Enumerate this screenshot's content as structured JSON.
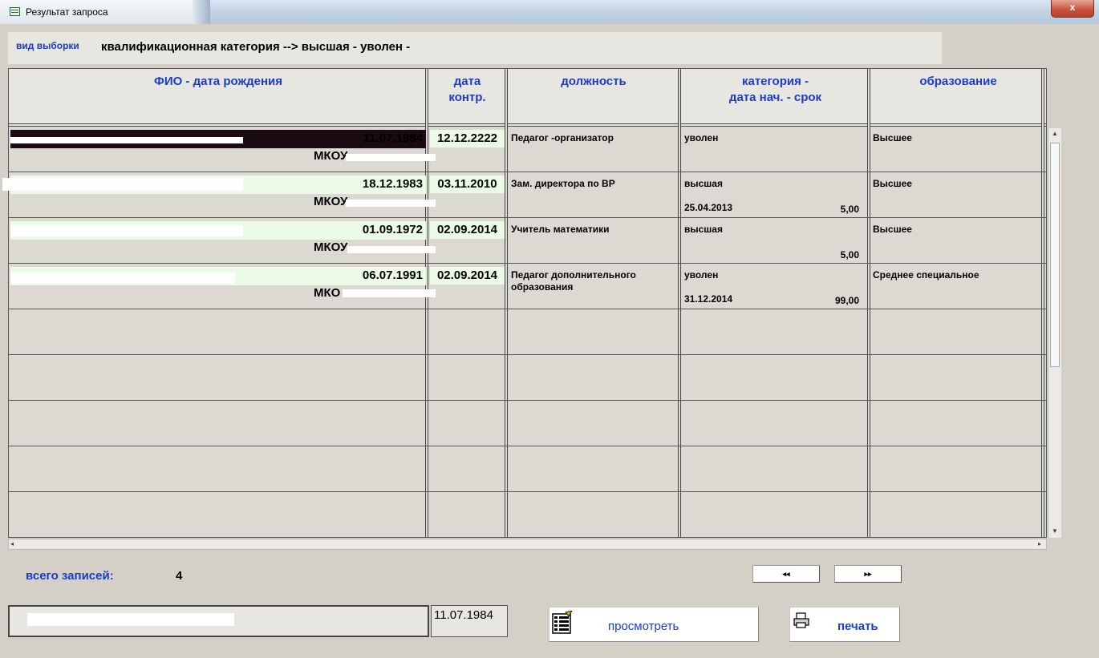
{
  "window": {
    "title": "Результат запроса",
    "close_label": "x"
  },
  "filter": {
    "label": "вид выборки",
    "value": "квалификационная категория -->  высшая  - уволен -"
  },
  "table": {
    "headers": {
      "fio": "ФИО - дата рождения",
      "contract_l1": "дата",
      "contract_l2": "контр.",
      "position": "должность",
      "category_l1": "категория -",
      "category_l2": "дата нач. - срок",
      "education": "образование"
    },
    "rows": [
      {
        "dob": "11.07.1984",
        "org": "МКОУ",
        "contract_date": "12.12.2222",
        "position": "Педагог -организатор",
        "category": "уволен",
        "start_date": "",
        "term": "",
        "education": "Высшее"
      },
      {
        "dob": "18.12.1983",
        "org": "МКОУ",
        "contract_date": "03.11.2010",
        "position": "Зам. директора по ВР",
        "category": "высшая",
        "start_date": "25.04.2013",
        "term": "5,00",
        "education": "Высшее"
      },
      {
        "dob": "01.09.1972",
        "org": "МКОУ",
        "contract_date": "02.09.2014",
        "position": "Учитель математики",
        "category": "высшая",
        "start_date": "",
        "term": "5,00",
        "education": "Высшее"
      },
      {
        "dob": "06.07.1991",
        "org": "МКО",
        "contract_date": "02.09.2014",
        "position": "Педагог дополнительного образования",
        "category": "уволен",
        "start_date": "31.12.2014",
        "term": "99,00",
        "education": "Среднее специальное"
      }
    ]
  },
  "footer": {
    "total_label": "всего записей:",
    "total_value": "4",
    "prev_label": "◂◂",
    "next_label": "▸▸",
    "selected_date": "11.07.1984",
    "view_label": "просмотреть",
    "print_label": "печать"
  }
}
